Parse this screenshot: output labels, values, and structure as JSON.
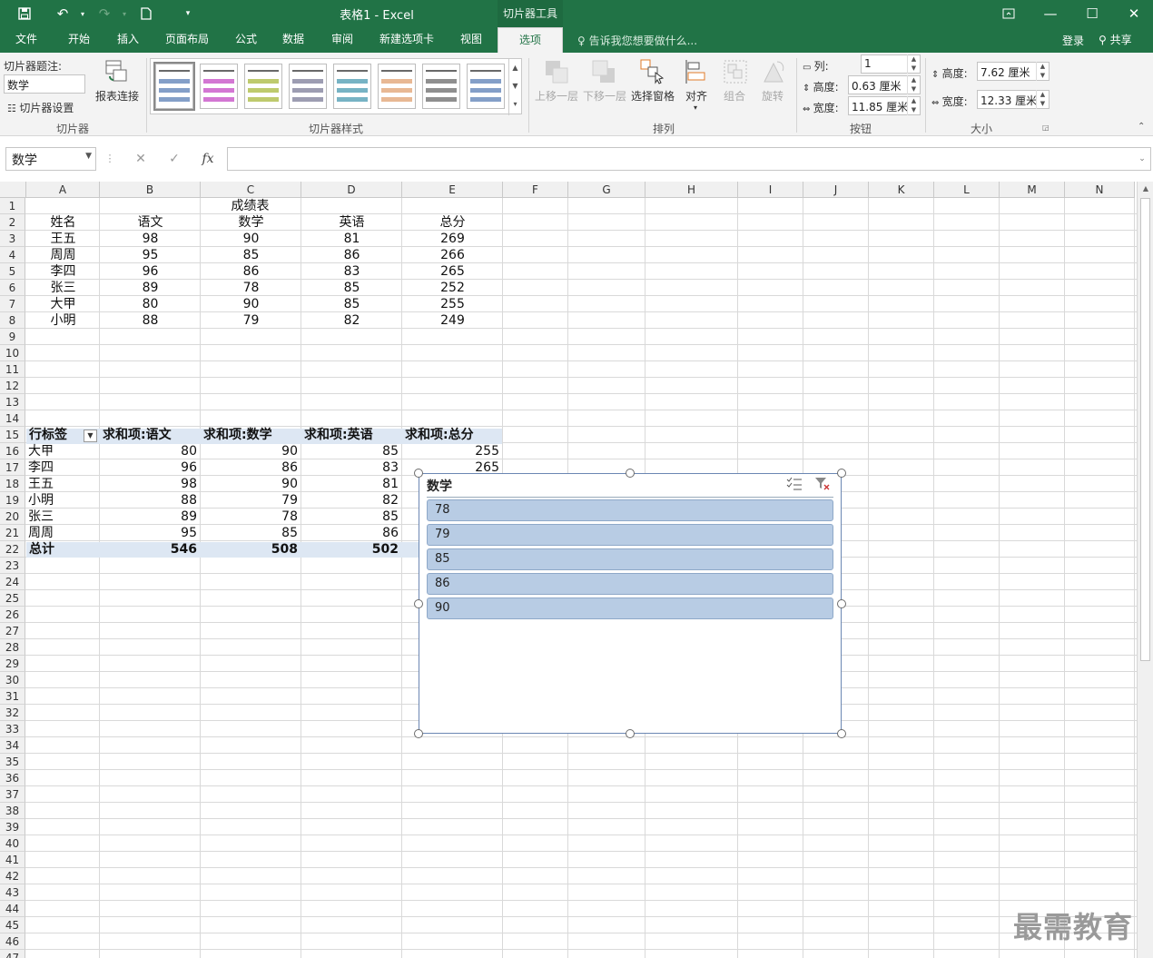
{
  "title": {
    "text": "表格1 - Excel",
    "tool_tab": "切片器工具"
  },
  "tabs": {
    "file": "文件",
    "home": "开始",
    "insert": "插入",
    "layout": "页面布局",
    "formulas": "公式",
    "data": "数据",
    "review": "审阅",
    "newtab": "新建选项卡",
    "view": "视图",
    "options": "选项",
    "tell_me": "告诉我您想要做什么...",
    "login": "登录",
    "share": "共享"
  },
  "ribbon": {
    "slicer_caption_label": "切片器题注:",
    "slicer_caption_value": "数学",
    "report_connections": "报表连接",
    "slicer_settings": "切片器设置",
    "group_slicer": "切片器",
    "group_styles": "切片器样式",
    "bring_forward": "上移一层",
    "send_backward": "下移一层",
    "selection_pane": "选择窗格",
    "align": "对齐",
    "group": "组合",
    "rotate": "旋转",
    "group_arrange": "排列",
    "columns_label": "列:",
    "columns_value": "1",
    "btn_height_label": "高度:",
    "btn_height_value": "0.63 厘米",
    "btn_width_label": "宽度:",
    "btn_width_value": "11.85 厘米",
    "group_buttons": "按钮",
    "size_height_label": "高度:",
    "size_height_value": "7.62 厘米",
    "size_width_label": "宽度:",
    "size_width_value": "12.33 厘米",
    "group_size": "大小",
    "style_colors": [
      "#5b7fb5",
      "#c44ac4",
      "#a8b83c",
      "#7c7c98",
      "#4a9ab0",
      "#e0a070",
      "#6a6a6a",
      "#5b7fb5"
    ]
  },
  "formula_bar": {
    "name_box": "数学",
    "fx": "fx",
    "value": ""
  },
  "columns": [
    "A",
    "B",
    "C",
    "D",
    "E",
    "F",
    "G",
    "H",
    "I",
    "J",
    "K",
    "L",
    "M",
    "N"
  ],
  "row_numbers": [
    "1",
    "2",
    "3",
    "4",
    "5",
    "6",
    "7",
    "8",
    "9",
    "10",
    "11",
    "12",
    "13",
    "14",
    "15",
    "16",
    "17",
    "18",
    "19",
    "20",
    "21",
    "22",
    "23",
    "24",
    "25",
    "26",
    "27",
    "28",
    "29",
    "30",
    "31",
    "32",
    "33",
    "34",
    "35",
    "36",
    "37",
    "38",
    "39",
    "40",
    "41",
    "42",
    "43",
    "44",
    "45",
    "46",
    "47"
  ],
  "score_table": {
    "title": "成绩表",
    "headers": [
      "姓名",
      "语文",
      "数学",
      "英语",
      "总分"
    ],
    "rows": [
      [
        "王五",
        "98",
        "90",
        "81",
        "269"
      ],
      [
        "周周",
        "95",
        "85",
        "86",
        "266"
      ],
      [
        "李四",
        "96",
        "86",
        "83",
        "265"
      ],
      [
        "张三",
        "89",
        "78",
        "85",
        "252"
      ],
      [
        "大甲",
        "80",
        "90",
        "85",
        "255"
      ],
      [
        "小明",
        "88",
        "79",
        "82",
        "249"
      ]
    ]
  },
  "pivot": {
    "headers": [
      "行标签",
      "求和项:语文",
      "求和项:数学",
      "求和项:英语",
      "求和项:总分"
    ],
    "rows": [
      [
        "大甲",
        "80",
        "90",
        "85",
        "255"
      ],
      [
        "李四",
        "96",
        "86",
        "83",
        "265"
      ],
      [
        "王五",
        "98",
        "90",
        "81",
        ""
      ],
      [
        "小明",
        "88",
        "79",
        "82",
        ""
      ],
      [
        "张三",
        "89",
        "78",
        "85",
        ""
      ],
      [
        "周周",
        "95",
        "85",
        "86",
        ""
      ]
    ],
    "total": [
      "总计",
      "546",
      "508",
      "502",
      ""
    ]
  },
  "slicer": {
    "title": "数学",
    "items": [
      "78",
      "79",
      "85",
      "86",
      "90"
    ]
  },
  "watermark": "最需教育"
}
